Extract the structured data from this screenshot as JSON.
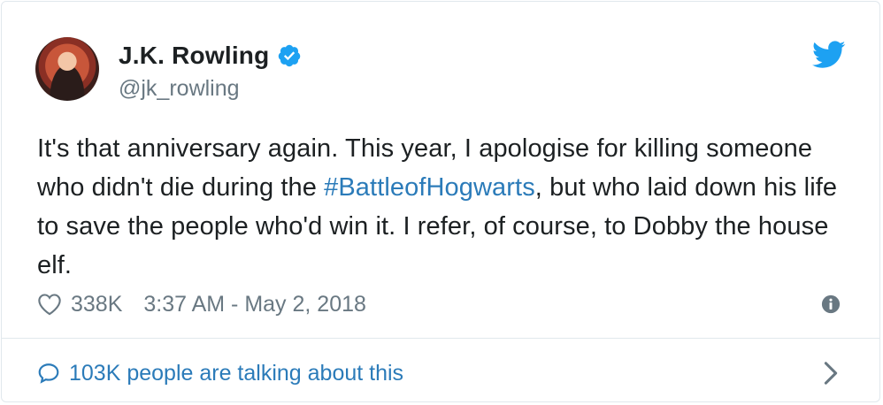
{
  "author": {
    "name": "J.K. Rowling",
    "handle": "@jk_rowling",
    "verified_icon": "verified-badge-icon",
    "avatar": "profile-photo"
  },
  "tweet": {
    "text_before": "It's that anniversary again. This year, I apologise for killing someone who didn't die during the ",
    "hashtag": "#BattleofHogwarts",
    "text_after": ", but who laid down his life to save the people who'd win it. I refer, of course, to Dobby the house elf."
  },
  "meta": {
    "likes": "338K",
    "timestamp": "3:37 AM - May 2, 2018"
  },
  "footer": {
    "talking": "103K people are talking about this"
  },
  "colors": {
    "link": "#2b7bb9",
    "twitter_blue": "#1da1f2",
    "muted": "#697882",
    "border": "#e1e8ed"
  },
  "icons": {
    "brand": "twitter-bird-icon",
    "like": "heart-icon",
    "info": "info-icon",
    "comment": "speech-bubble-icon",
    "navigate": "chevron-right-icon"
  }
}
